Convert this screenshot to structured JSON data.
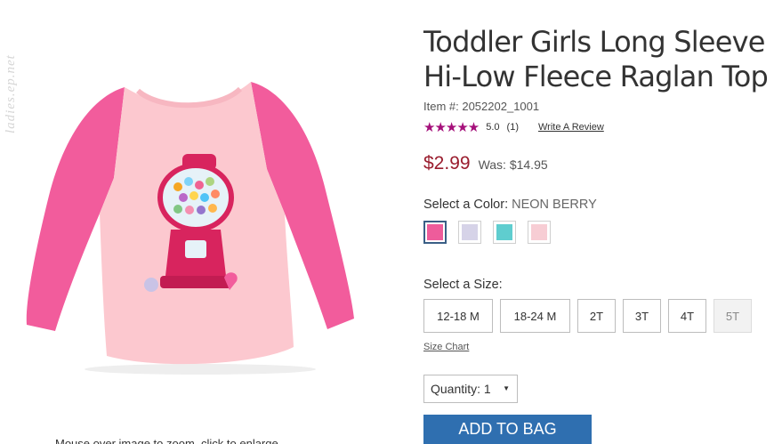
{
  "watermark": "ladies.ep.net",
  "product": {
    "title_line1": "Toddler Girls Long Sleeve",
    "title_line2": "Hi-Low Fleece Raglan Top",
    "item_number": "Item #: 2052202_1001",
    "rating": {
      "stars": "★★★★★",
      "score": "5.0",
      "count": "(1)",
      "write_review": "Write A Review"
    },
    "price": "$2.99",
    "was_price": "Was: $14.95",
    "color": {
      "label": "Select a Color:",
      "selected": "NEON BERRY",
      "swatches": [
        {
          "name": "neon-berry",
          "hex": "#ee5c9b",
          "selected": true
        },
        {
          "name": "lavender",
          "hex": "#d6d3e8",
          "selected": false
        },
        {
          "name": "aqua",
          "hex": "#5fcdcf",
          "selected": false
        },
        {
          "name": "light-pink",
          "hex": "#f7cdd4",
          "selected": false
        }
      ]
    },
    "size": {
      "label": "Select a Size:",
      "options": [
        "12-18 M",
        "18-24 M",
        "2T",
        "3T",
        "4T",
        "5T"
      ],
      "disabled": [
        "5T"
      ],
      "chart_link": "Size Chart"
    },
    "quantity": {
      "label": "Quantity:",
      "value": "1"
    },
    "add_to_bag": "ADD TO BAG",
    "image_caption": "Mouse over image to zoom, click to enlarge"
  },
  "colors": {
    "price_red": "#9a1d2e",
    "star_magenta": "#a5107a",
    "button_blue": "#2f6fb0",
    "selected_border": "#3a5f86"
  }
}
